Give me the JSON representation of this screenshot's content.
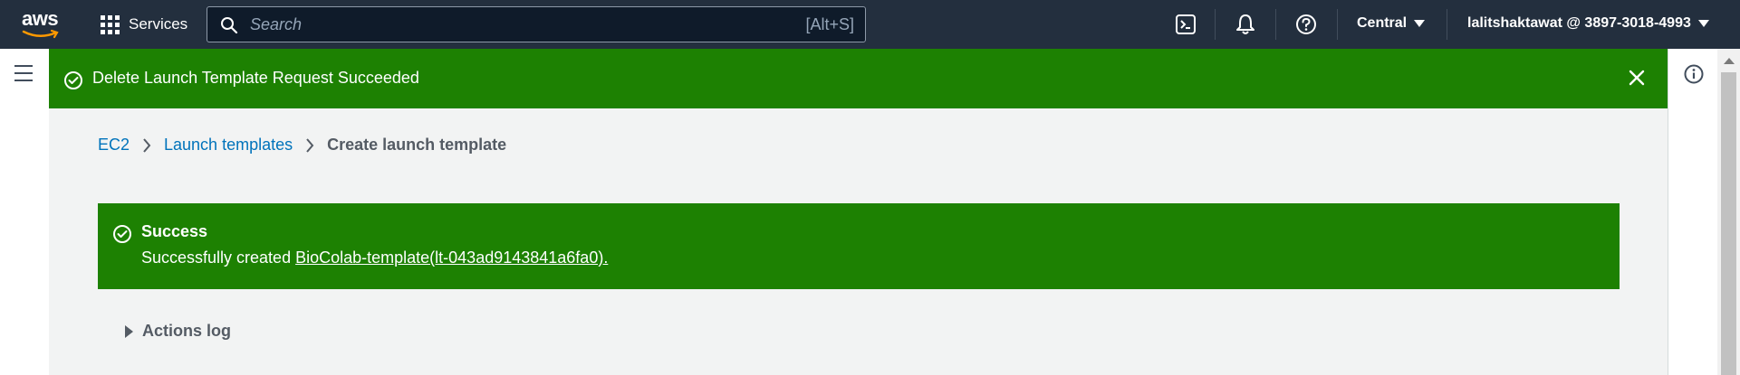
{
  "topnav": {
    "logo_text": "aws",
    "services_label": "Services",
    "search_placeholder": "Search",
    "search_shortcut": "[Alt+S]",
    "region_label": "Central",
    "account_label": "lalitshaktawat @ 3897-3018-4993",
    "icons": [
      "cloudshell-icon",
      "bell-icon",
      "help-icon"
    ]
  },
  "flash": {
    "message": "Delete Launch Template Request Succeeded",
    "color": "#1d8102"
  },
  "breadcrumb": {
    "items": [
      "EC2",
      "Launch templates"
    ],
    "current": "Create launch template"
  },
  "alert": {
    "title": "Success",
    "body_prefix": "Successfully created",
    "link_text": "BioColab-template(lt-043ad9143841a6fa0)."
  },
  "actions_log": {
    "label": "Actions log"
  },
  "colors": {
    "nav_bg": "#232f3e",
    "success": "#1d8102",
    "link": "#0073bb",
    "page_bg": "#f2f3f3"
  }
}
